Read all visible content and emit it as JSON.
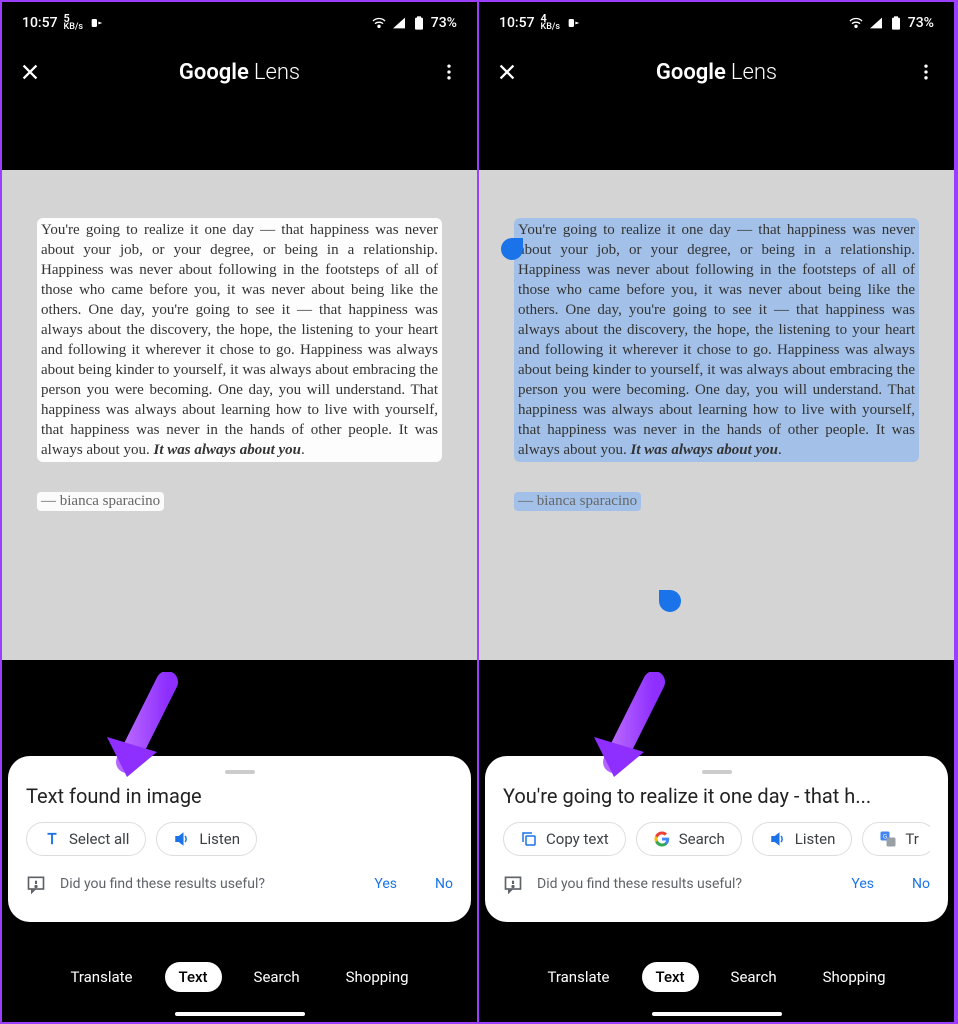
{
  "status": {
    "time": "10:57",
    "kbs_left": "5",
    "kbs_right": "4",
    "kbs_unit": "KB/s",
    "battery": "73%"
  },
  "app": {
    "title_bold": "Google",
    "title_light": "Lens"
  },
  "quote": {
    "body": "You're going to realize it one day — that happiness was never about your job, or your degree, or being in a relationship. Happiness was never about following in the footsteps of all of those who came before you, it was never about being like the others. One day, you're going to see it — that happiness was always about the discovery, the hope, the listening to your heart and following it wherever it chose to go. Happiness was always about being kinder to yourself, it was always about embracing the person you were becoming. One day, you will understand. That happiness was always about learning how to live with yourself, that happiness was never in the hands of other people. It was always about you. ",
    "body_bold": "It was always about you",
    "body_tail": ".",
    "author": "— bianca sparacino"
  },
  "left_sheet": {
    "title": "Text found in image",
    "chips": {
      "select_all": "Select all",
      "listen": "Listen"
    }
  },
  "right_sheet": {
    "title": "You're going to realize it one day - that h...",
    "chips": {
      "copy": "Copy text",
      "search": "Search",
      "listen": "Listen",
      "translate": "Tr"
    }
  },
  "feedback": {
    "prompt": "Did you find these results useful?",
    "yes": "Yes",
    "no": "No"
  },
  "tabs": {
    "translate": "Translate",
    "text": "Text",
    "search": "Search",
    "shopping": "Shopping"
  },
  "colors": {
    "accent": "#1a73e8",
    "arrow": "#9b3fff"
  }
}
